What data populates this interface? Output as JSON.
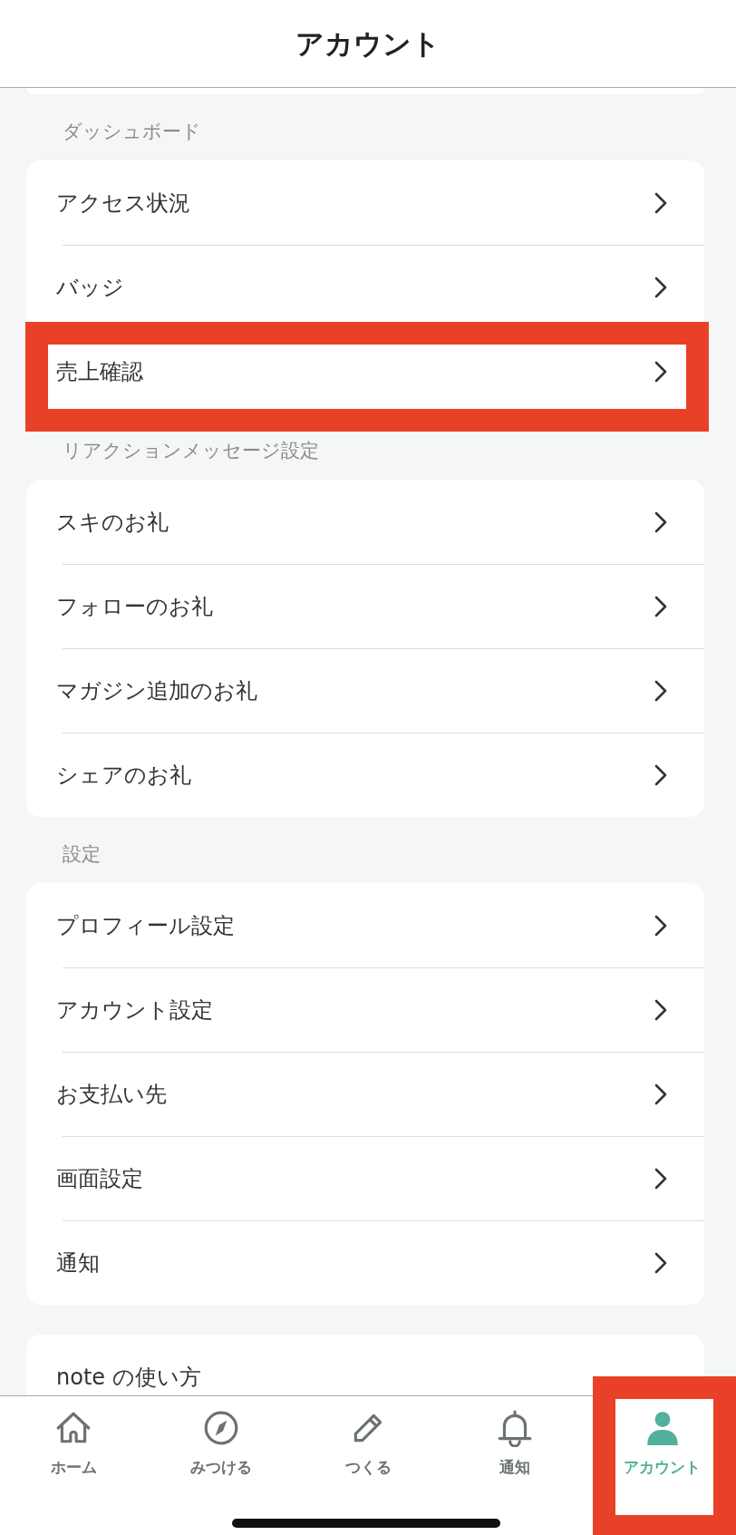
{
  "header": {
    "title": "アカウント"
  },
  "sections": [
    {
      "label": "ダッシュボード",
      "items": [
        {
          "label": "アクセス状況",
          "highlighted": false
        },
        {
          "label": "バッジ",
          "highlighted": false
        },
        {
          "label": "売上確認",
          "highlighted": true
        }
      ]
    },
    {
      "label": "リアクションメッセージ設定",
      "items": [
        {
          "label": "スキのお礼",
          "highlighted": false
        },
        {
          "label": "フォローのお礼",
          "highlighted": false
        },
        {
          "label": "マガジン追加のお礼",
          "highlighted": false
        },
        {
          "label": "シェアのお礼",
          "highlighted": false
        }
      ]
    },
    {
      "label": "設定",
      "items": [
        {
          "label": "プロフィール設定",
          "highlighted": false
        },
        {
          "label": "アカウント設定",
          "highlighted": false
        },
        {
          "label": "お支払い先",
          "highlighted": false
        },
        {
          "label": "画面設定",
          "highlighted": false
        },
        {
          "label": "通知",
          "highlighted": false
        }
      ]
    },
    {
      "items": [
        {
          "label": "note の使い方",
          "highlighted": false,
          "chevron": false
        }
      ]
    }
  ],
  "tab_bar": [
    {
      "label": "ホーム",
      "selected": false,
      "highlighted": false
    },
    {
      "label": "みつける",
      "selected": false,
      "highlighted": false
    },
    {
      "label": "つくる",
      "selected": false,
      "highlighted": false
    },
    {
      "label": "通知",
      "selected": false,
      "highlighted": false
    },
    {
      "label": "アカウント",
      "selected": true,
      "highlighted": true
    }
  ]
}
